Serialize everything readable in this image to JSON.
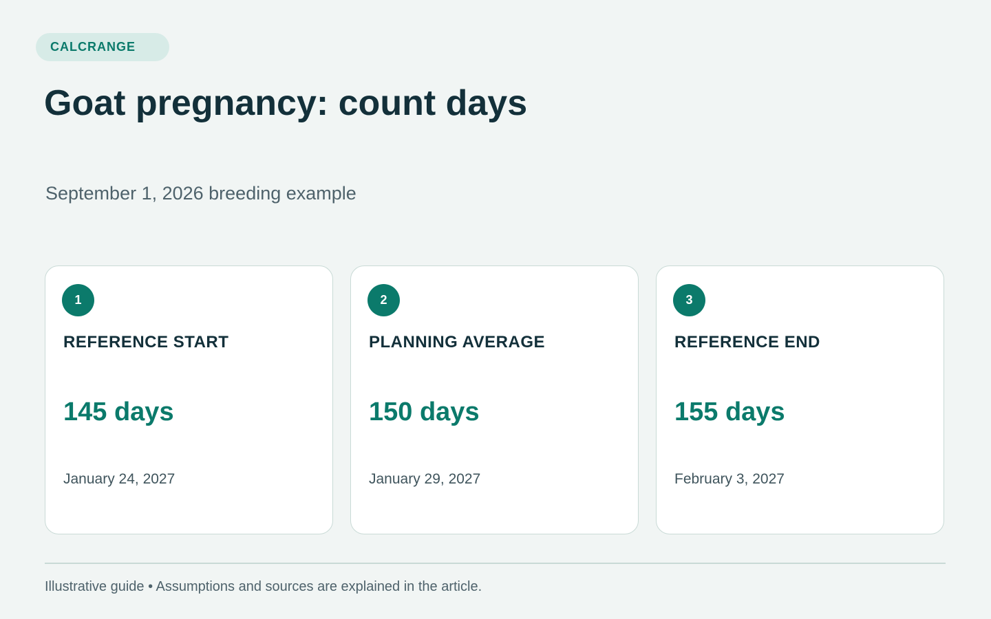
{
  "badge": "CALCRANGE",
  "title": "Goat pregnancy: count days",
  "subtitle": "September 1, 2026 breeding example",
  "cards": [
    {
      "number": "1",
      "label": "REFERENCE START",
      "value": "145 days",
      "date": "January 24, 2027"
    },
    {
      "number": "2",
      "label": "PLANNING AVERAGE",
      "value": "150 days",
      "date": "January 29, 2027"
    },
    {
      "number": "3",
      "label": "REFERENCE END",
      "value": "155 days",
      "date": "February 3, 2027"
    }
  ],
  "footer": "Illustrative guide • Assumptions and sources are explained in the article.",
  "colors": {
    "accent": "#0b7a6b",
    "background": "#f1f5f4",
    "heading": "#13303a"
  }
}
